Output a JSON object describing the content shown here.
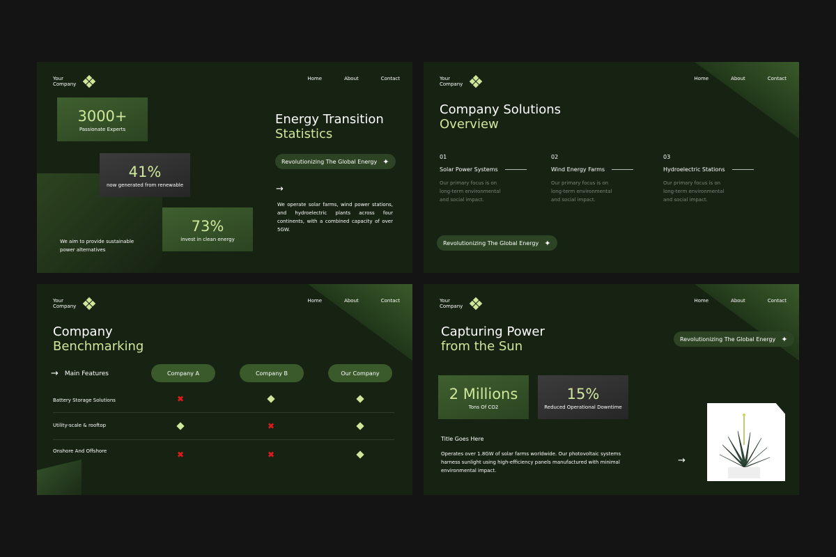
{
  "brand": {
    "line1": "Your",
    "line2": "Company"
  },
  "nav": {
    "home": "Home",
    "about": "About",
    "contact": "Contact"
  },
  "colors": {
    "accent": "#cfe79a",
    "background": "#162313",
    "page": "#141414",
    "pill": "#2c4424",
    "cross": "#e01a1a"
  },
  "slide1": {
    "heading_white": "Energy Transition",
    "heading_green": "Statistics",
    "pill": "Revolutionizing The Global Energy",
    "stats": [
      {
        "value": "3000+",
        "caption": "Passionate Experts"
      },
      {
        "value": "41%",
        "caption": "now generated from renewable"
      },
      {
        "value": "73%",
        "caption": "invest in clean energy"
      }
    ],
    "aim_line1": "We aim to provide sustainable",
    "aim_line2": "power alternatives",
    "body": "We operate solar farms, wind power stations, and hydroelectric plants across four continents, with a combined capacity of over 5GW."
  },
  "slide2": {
    "heading_white": "Company Solutions",
    "heading_green": "Overview",
    "solutions": [
      {
        "num": "01",
        "title": "Solar Power Systems",
        "desc": "Our primary focus is on long-term environmental and social impact."
      },
      {
        "num": "02",
        "title": "Wind Energy Farms",
        "desc": "Our primary focus is on long-term environmental and social impact."
      },
      {
        "num": "03",
        "title": "Hydroelectric Stations",
        "desc": "Our primary focus is on long-term environmental and social impact."
      }
    ],
    "pill": "Revolutionizing The Global Energy"
  },
  "slide3": {
    "heading_white": "Company",
    "heading_green": "Benchmarking",
    "main_features": "Main Features",
    "columns": [
      "Company A",
      "Company B",
      "Our Company"
    ],
    "rows": [
      {
        "label": "Battery Storage Solutions",
        "values": [
          false,
          true,
          true
        ]
      },
      {
        "label": "Utility-scale & rooftop",
        "values": [
          true,
          false,
          true
        ]
      },
      {
        "label": "Onshore And Offshore",
        "values": [
          false,
          false,
          true
        ]
      }
    ]
  },
  "slide4": {
    "heading_white": "Capturing Power",
    "heading_green": "from the Sun",
    "pill": "Revolutionizing The Global Energy",
    "stats": [
      {
        "value": "2 Millions",
        "caption": "Tons Of CO2"
      },
      {
        "value": "15%",
        "caption": "Reduced Operational Downtime"
      }
    ],
    "title": "Title Goes Here",
    "body": "Operates over 1.8GW of solar farms worldwide. Our photovoltaic systems harness sunlight using high-efficiency panels manufactured with minimal environmental impact."
  }
}
